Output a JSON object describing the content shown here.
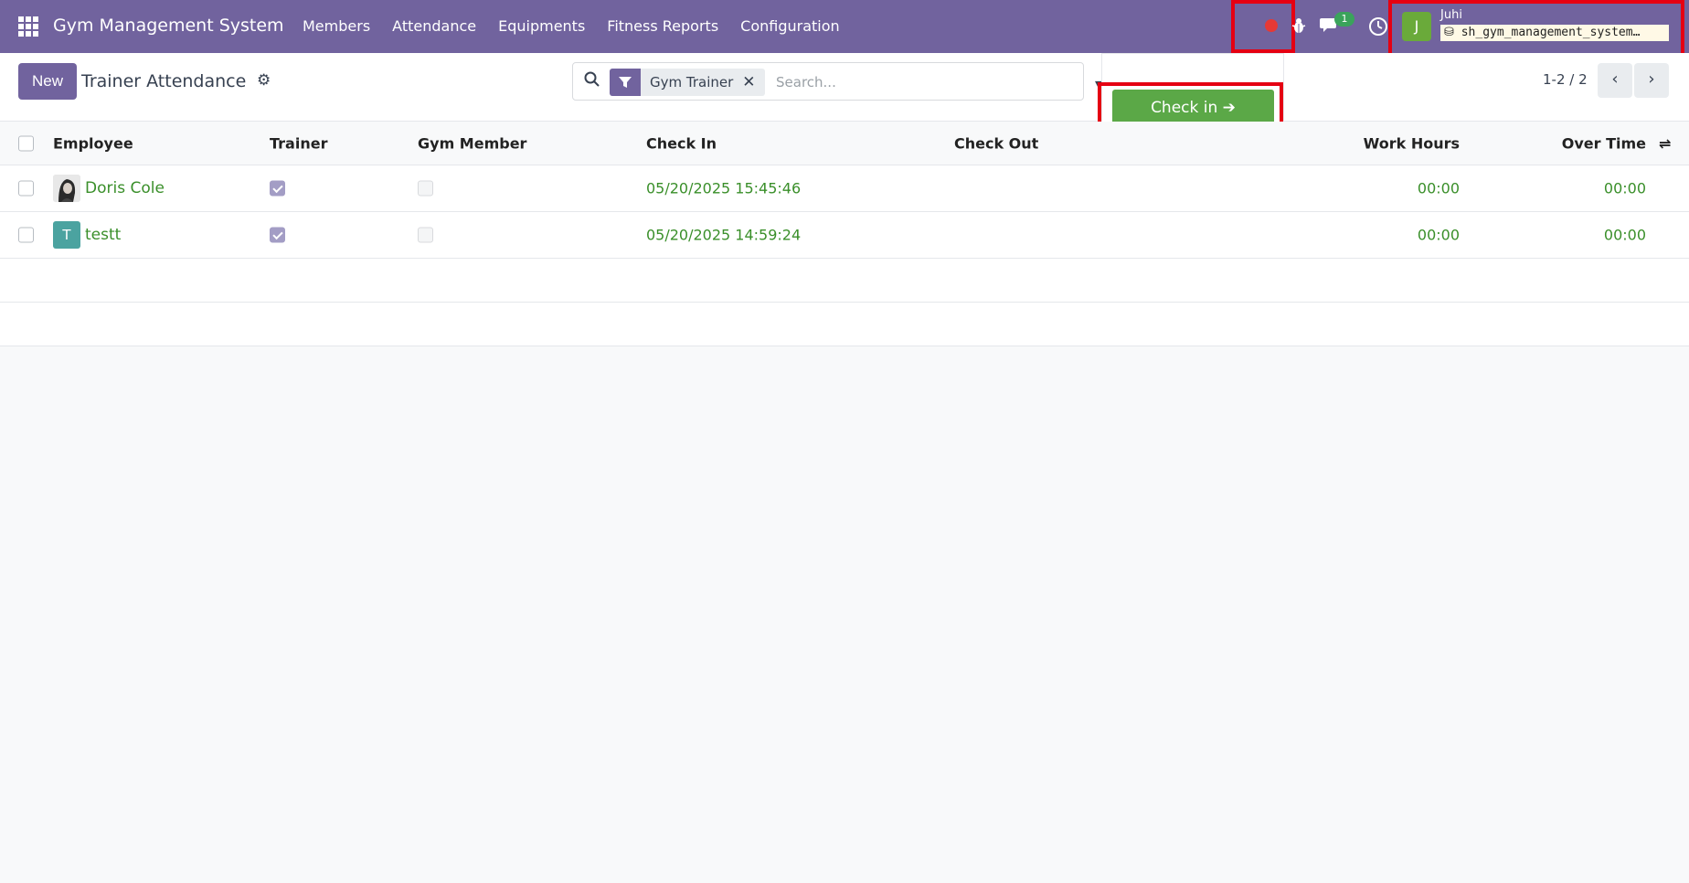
{
  "navbar": {
    "brand": "Gym Management System",
    "menu": [
      "Members",
      "Attendance",
      "Equipments",
      "Fitness Reports",
      "Configuration"
    ],
    "messages_badge": "1",
    "user_initial": "J",
    "user_name": "Juhi",
    "database": "sh_gym_management_system…"
  },
  "control": {
    "new_label": "New",
    "title": "Trainer Attendance",
    "facet_label": "Gym Trainer",
    "search_placeholder": "Search...",
    "pager": "1-2 / 2"
  },
  "dropdown": {
    "checkin_label": "Check in ➔"
  },
  "table": {
    "columns": {
      "employee": "Employee",
      "trainer": "Trainer",
      "gym_member": "Gym Member",
      "check_in": "Check In",
      "check_out": "Check Out",
      "work_hours": "Work Hours",
      "over_time": "Over Time"
    },
    "rows": [
      {
        "employee": "Doris Cole",
        "avatar": "photo",
        "trainer": true,
        "gym_member": false,
        "check_in": "05/20/2025 15:45:46",
        "check_out": "",
        "work_hours": "00:00",
        "over_time": "00:00"
      },
      {
        "employee": "testt",
        "avatar": "T",
        "trainer": true,
        "gym_member": false,
        "check_in": "05/20/2025 14:59:24",
        "check_out": "",
        "work_hours": "00:00",
        "over_time": "00:00"
      }
    ]
  },
  "colors": {
    "brand": "#71639e",
    "success": "#5ba847",
    "highlight": "#e50012"
  }
}
